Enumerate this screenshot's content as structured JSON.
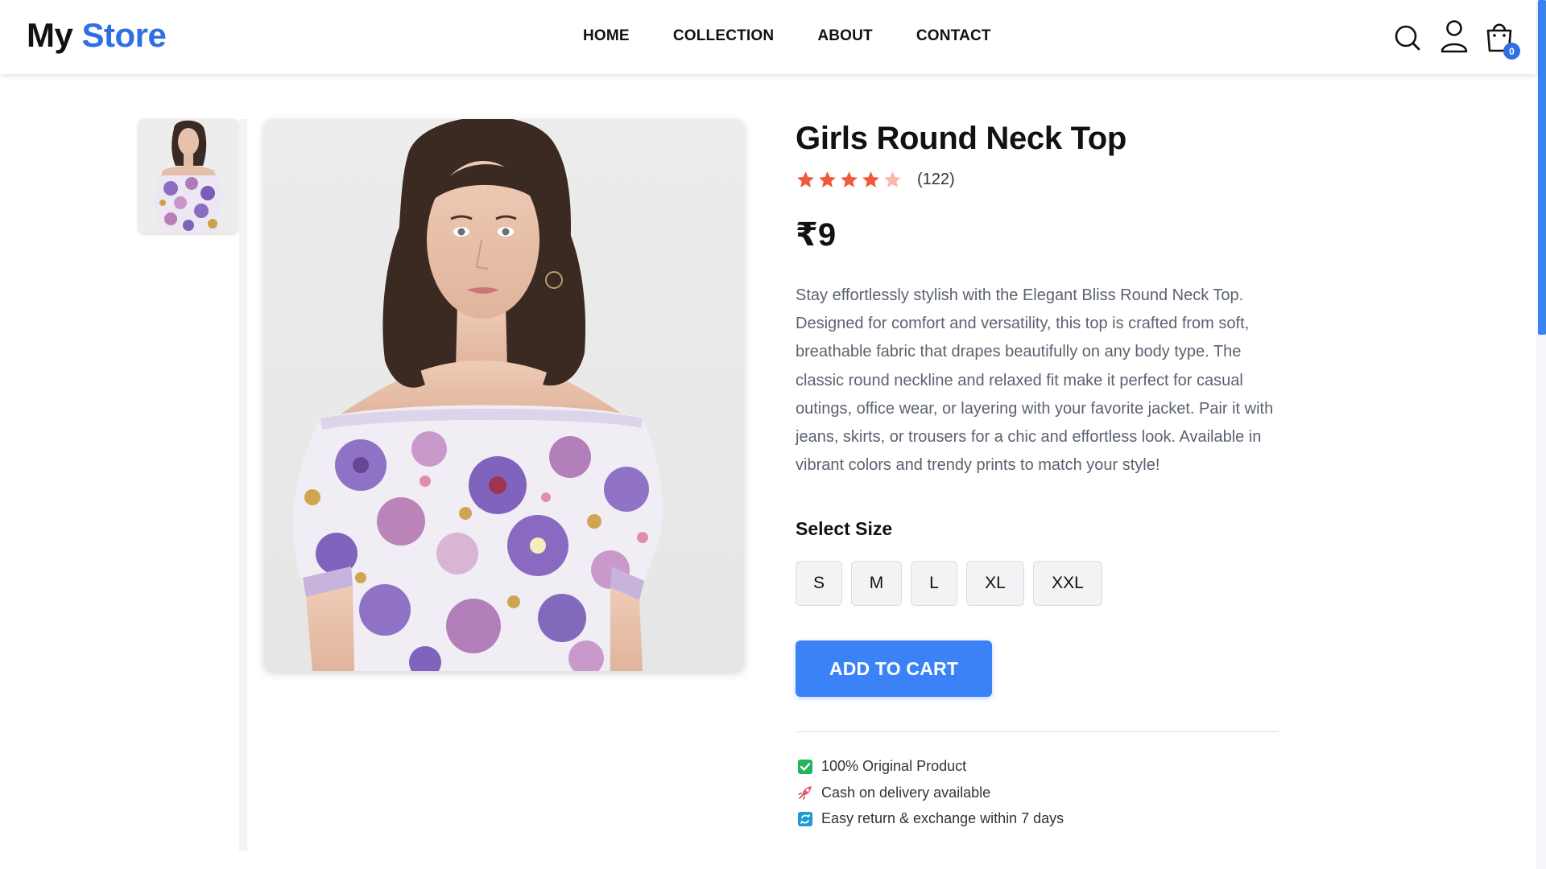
{
  "brand": {
    "name_part1": "My",
    "name_part2": "Store",
    "accent_color": "#2f6fe4"
  },
  "nav": {
    "items": [
      "HOME",
      "COLLECTION",
      "ABOUT",
      "CONTACT"
    ]
  },
  "header_icons": {
    "search": "search-icon",
    "profile": "user-icon",
    "cart": "shopping-bag-icon",
    "cart_count": "0"
  },
  "product": {
    "title": "Girls Round Neck Top",
    "rating": {
      "stars": 4,
      "max": 5,
      "count_text": "(122)",
      "star_color": "#ef5a3c",
      "empty_star_color": "#f8b8aa"
    },
    "price": "₹9",
    "description": "Stay effortlessly stylish with the Elegant Bliss Round Neck Top. Designed for comfort and versatility, this top is crafted from soft, breathable fabric that drapes beautifully on any body type. The classic round neckline and relaxed fit make it perfect for casual outings, office wear, or layering with your favorite jacket. Pair it with jeans, skirts, or trousers for a chic and effortless look. Available in vibrant colors and trendy prints to match your style!",
    "images": {
      "thumbnail": "product-photo-thumbnail",
      "main": "product-photo-main"
    }
  },
  "size_section": {
    "label": "Select Size",
    "sizes": [
      "S",
      "M",
      "L",
      "XL",
      "XXL"
    ]
  },
  "cart_button": {
    "label": "ADD TO CART",
    "color": "#3b82f6"
  },
  "perks": [
    {
      "icon": "check-box-icon",
      "text": "100% Original Product"
    },
    {
      "icon": "rocket-icon",
      "text": "Cash on delivery available"
    },
    {
      "icon": "exchange-icon",
      "text": "Easy return & exchange within 7 days"
    }
  ]
}
